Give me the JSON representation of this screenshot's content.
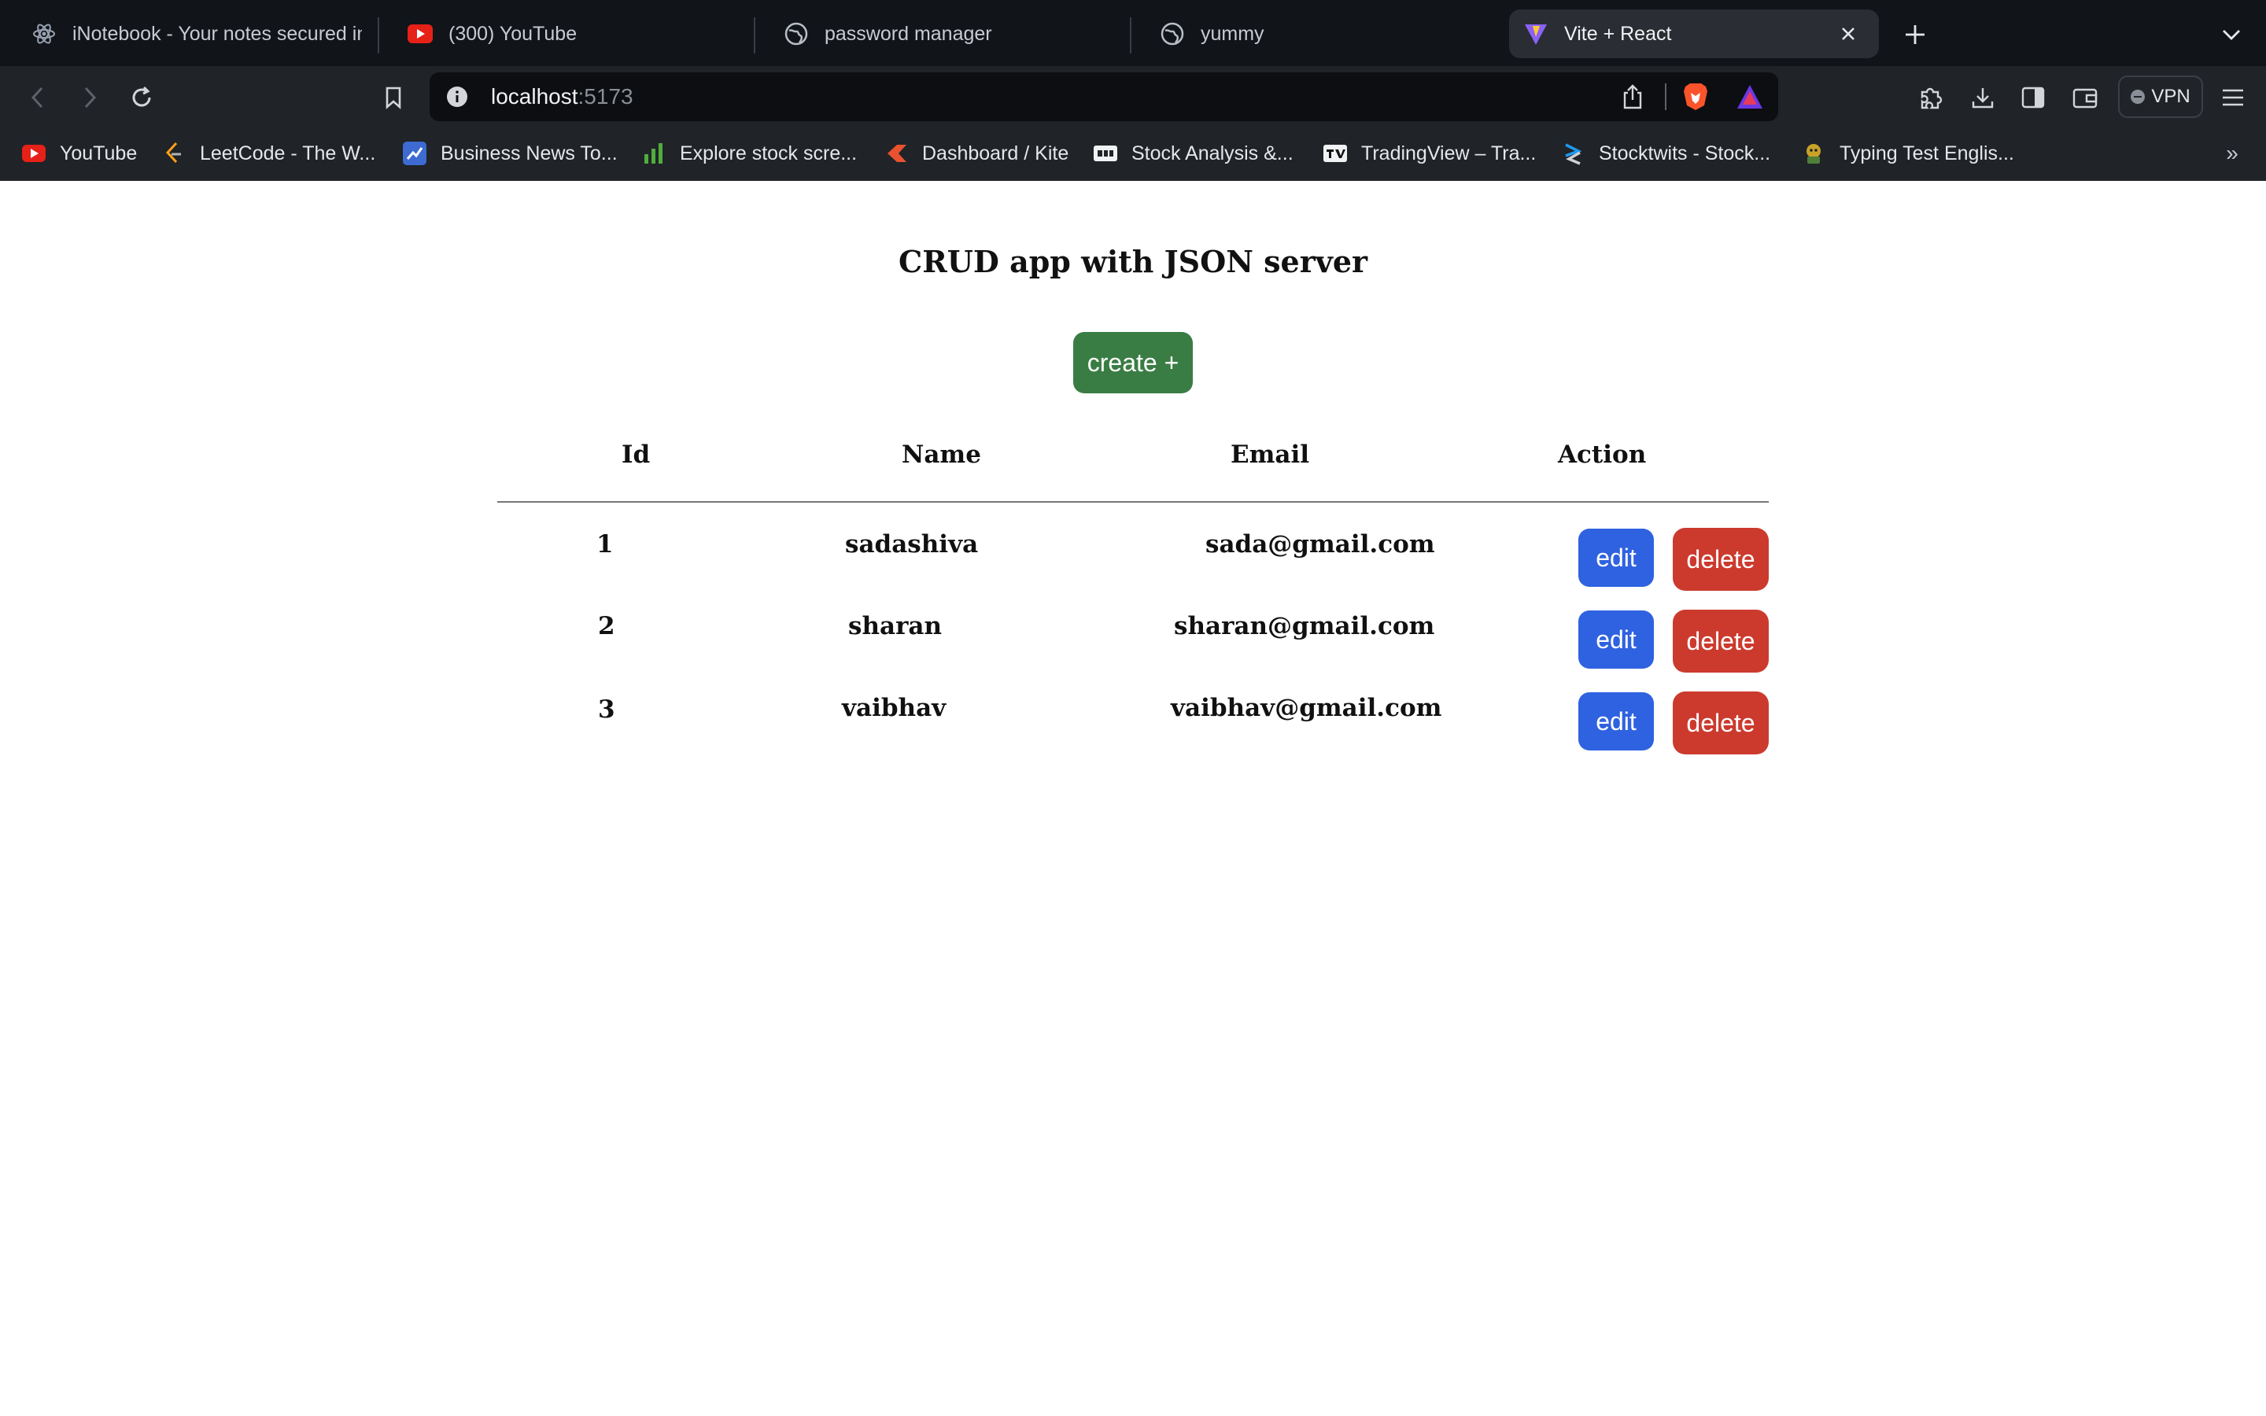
{
  "browser": {
    "tabs": [
      {
        "title": "iNotebook - Your notes secured in the cloud",
        "icon": "react-icon",
        "active": false
      },
      {
        "title": "(300) YouTube",
        "icon": "youtube-icon",
        "active": false
      },
      {
        "title": "password manager",
        "icon": "globe-icon",
        "active": false
      },
      {
        "title": "yummy",
        "icon": "globe-icon",
        "active": false
      },
      {
        "title": "Vite + React",
        "icon": "vite-icon",
        "active": true
      }
    ],
    "url": {
      "host": "localhost",
      "port": ":5173"
    },
    "vpn_label": "VPN",
    "bookmarks": [
      {
        "label": "YouTube",
        "icon": "youtube-icon"
      },
      {
        "label": "LeetCode - The W...",
        "icon": "leetcode-icon"
      },
      {
        "label": "Business News To...",
        "icon": "news-icon"
      },
      {
        "label": "Explore stock scre...",
        "icon": "bar-chart-icon"
      },
      {
        "label": "Dashboard / Kite",
        "icon": "kite-icon"
      },
      {
        "label": "Stock Analysis &...",
        "icon": "stock-analysis-icon"
      },
      {
        "label": "TradingView – Tra...",
        "icon": "tradingview-icon"
      },
      {
        "label": "Stocktwits - Stock...",
        "icon": "stocktwits-icon"
      },
      {
        "label": "Typing Test Englis...",
        "icon": "typing-icon"
      }
    ],
    "bookmarks_more": "»",
    "colors": {
      "tabbar": "#111419",
      "toolbar": "#202328",
      "urlbar": "#0c0e11"
    }
  },
  "app": {
    "title": "CRUD app with JSON server",
    "create_label": "create +",
    "columns": [
      "Id",
      "Name",
      "Email",
      "Action"
    ],
    "rows": [
      {
        "id": "1",
        "name": "sadashiva",
        "email": "sada@gmail.com"
      },
      {
        "id": "2",
        "name": "sharan",
        "email": "sharan@gmail.com"
      },
      {
        "id": "3",
        "name": "vaibhav",
        "email": "vaibhav@gmail.com"
      }
    ],
    "edit_label": "edit",
    "delete_label": "delete",
    "colors": {
      "create": "#3a7d44",
      "edit": "#2f62e0",
      "delete": "#cc3a2e"
    }
  }
}
